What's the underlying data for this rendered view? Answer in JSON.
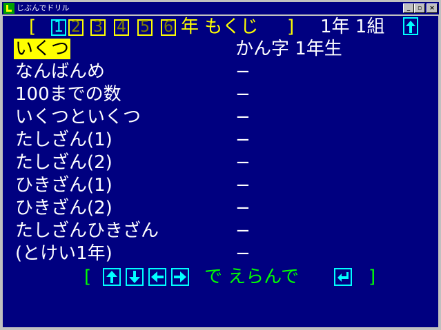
{
  "window": {
    "title": "じぶんでドリル"
  },
  "header": {
    "open_bracket": "[",
    "grades": [
      "1",
      "2",
      "3",
      "4",
      "5",
      "6"
    ],
    "selected_grade": 0,
    "suffix": "年 もくじ",
    "close_bracket": "]",
    "class_label": "1年 1組"
  },
  "menu": {
    "items": [
      {
        "label": "いくつ",
        "value": "かん字 1年生"
      },
      {
        "label": "なんばんめ",
        "value": "−"
      },
      {
        "label": "100までの数",
        "value": "−"
      },
      {
        "label": "いくつといくつ",
        "value": "−"
      },
      {
        "label": "たしざん(1)",
        "value": "−"
      },
      {
        "label": "たしざん(2)",
        "value": "−"
      },
      {
        "label": "ひきざん(1)",
        "value": "−"
      },
      {
        "label": "ひきざん(2)",
        "value": "−"
      },
      {
        "label": "たしざんひきざん",
        "value": "−"
      },
      {
        "label": "(とけい1年)",
        "value": "−"
      }
    ],
    "selected_index": 0
  },
  "footer": {
    "open_bracket": "[",
    "instruction": "で えらんで",
    "close_bracket": "]",
    "arrow_icons": [
      "up-arrow-icon",
      "down-arrow-icon",
      "left-arrow-icon",
      "right-arrow-icon"
    ],
    "enter_icon": "enter-icon"
  },
  "colors": {
    "background": "#000080",
    "highlight": "#ffff00",
    "accent": "#00ffff",
    "hint": "#00ff00"
  }
}
